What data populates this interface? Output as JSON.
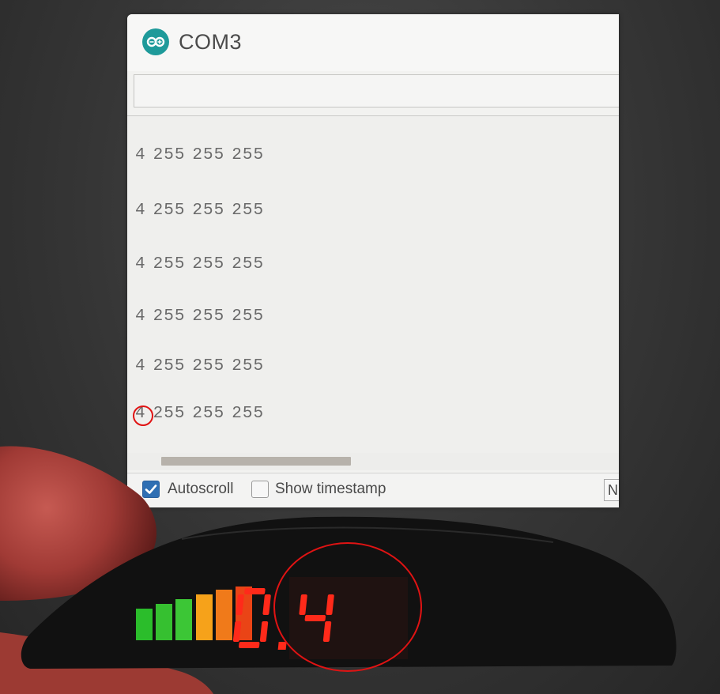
{
  "window": {
    "title": "COM3",
    "icon": "arduino-infinity-icon"
  },
  "send_input": {
    "value": "",
    "placeholder": ""
  },
  "serial_output": [
    [
      "4",
      "255",
      "255",
      "255"
    ],
    [
      "4",
      "255",
      "255",
      "255"
    ],
    [
      "4",
      "255",
      "255",
      "255"
    ],
    [
      "4",
      "255",
      "255",
      "255"
    ],
    [
      "4",
      "255",
      "255",
      "255"
    ],
    [
      "4",
      "255",
      "255",
      "255"
    ]
  ],
  "footer": {
    "autoscroll_label": "Autoscroll",
    "autoscroll_checked": true,
    "timestamp_label": "Show timestamp",
    "timestamp_checked": false,
    "line_ending_visible": "N"
  },
  "display": {
    "value": "0.4",
    "digit_color": "#ff2a1a",
    "bar_levels": [
      {
        "color": "#2bbd2b"
      },
      {
        "color": "#36c030"
      },
      {
        "color": "#3cc636"
      },
      {
        "color": "#f6a21a"
      },
      {
        "color": "#f07a1a"
      },
      {
        "color": "#ea4416"
      }
    ]
  },
  "colors": {
    "marker": "#e01313",
    "accent": "#1e9a9a",
    "checkbox": "#2f6fb3"
  }
}
